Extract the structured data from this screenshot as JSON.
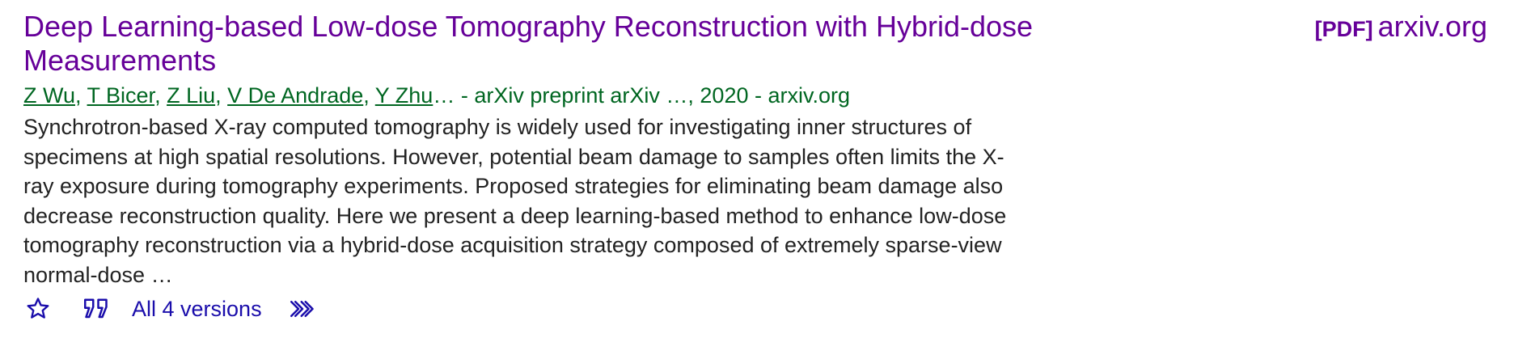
{
  "result": {
    "title": "Deep Learning-based Low-dose Tomography Reconstruction with Hybrid-dose Measurements",
    "authors": [
      "Z Wu",
      "T Bicer",
      "Z Liu",
      "V De Andrade",
      "Y Zhu"
    ],
    "author_separator": ", ",
    "source_tail": "… - arXiv preprint arXiv …, 2020 - arxiv.org",
    "snippet": "Synchrotron-based X-ray computed tomography is widely used for investigating inner structures of specimens at high spatial resolutions. However, potential beam damage to samples often limits the X-ray exposure during tomography experiments. Proposed strategies for eliminating beam damage also decrease reconstruction quality. Here we present a deep learning-based method to enhance low-dose tomography reconstruction via a hybrid-dose acquisition strategy composed of extremely sparse-view normal-dose …",
    "side_link": {
      "format": "[PDF]",
      "domain": "arxiv.org"
    },
    "actions": {
      "save_icon": "star-icon",
      "cite_icon": "quote-icon",
      "versions_label": "All 4 versions",
      "more_icon": "double-chevron-right-icon"
    }
  },
  "colors": {
    "title": "#660099",
    "meta": "#006621",
    "snippet": "#222222",
    "action": "#1a0dab"
  }
}
